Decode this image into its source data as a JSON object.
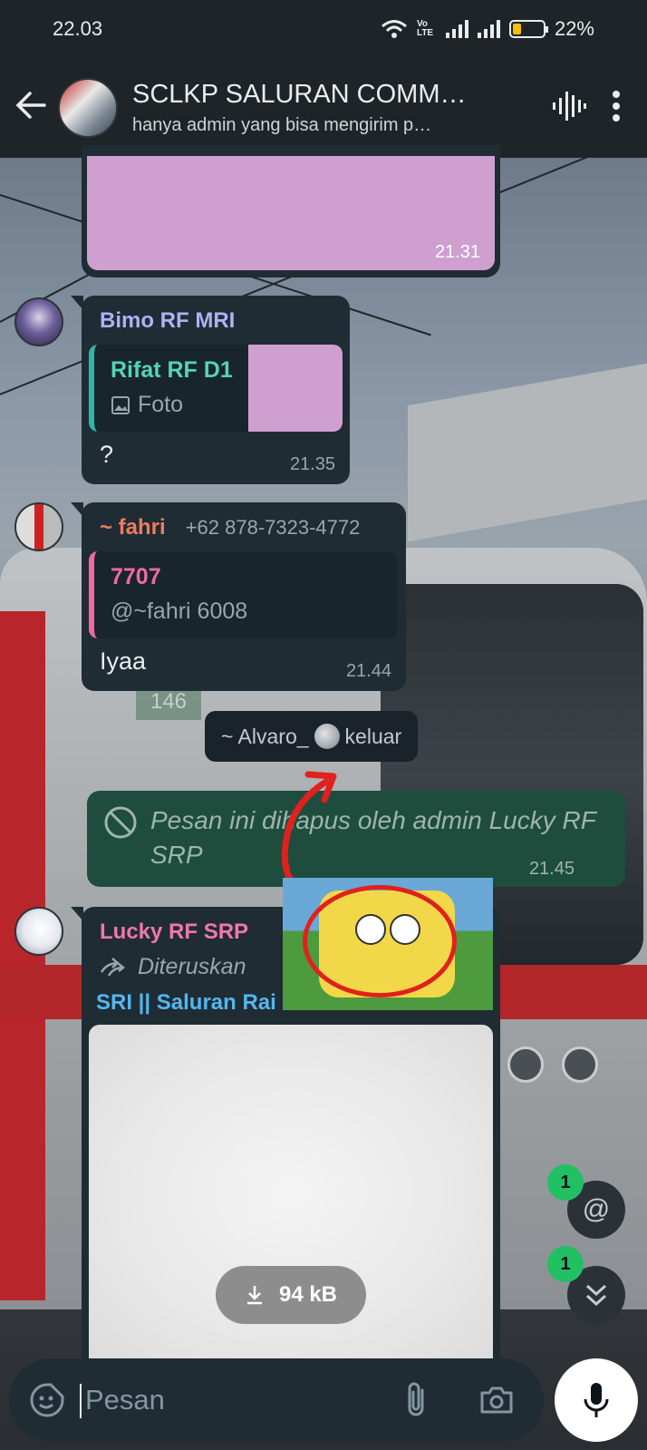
{
  "status_bar": {
    "time": "22.03",
    "volte": "Vo LTE",
    "battery": "22%"
  },
  "header": {
    "title": "SCLKP SALURAN COMM…",
    "subtitle": "hanya admin yang bisa mengirim p…"
  },
  "messages": {
    "m1": {
      "time": "21.31"
    },
    "m2": {
      "sender": "Bimo RF MRI",
      "quote_name": "Rifat RF D1",
      "quote_text": "Foto",
      "text": "?",
      "time": "21.35"
    },
    "m3": {
      "sender": "~ fahri",
      "phone": "+62 878-7323-4772",
      "quote_name": "7707",
      "quote_text": "@~fahri 6008",
      "text": "Iyaa",
      "time": "21.44"
    },
    "system": {
      "text_before": "~ Alvaro_",
      "text_after": "keluar"
    },
    "deleted": {
      "text": "Pesan ini dihapus oleh admin Lucky RF SRP",
      "time": "21.45"
    },
    "m4": {
      "sender": "Lucky RF SRP",
      "forwarded": "Diteruskan",
      "channel": "SRI || Saluran Rai",
      "download_size": "94 kB"
    }
  },
  "badges": {
    "mention_count": "1",
    "scroll_count": "1"
  },
  "input": {
    "placeholder": "Pesan"
  },
  "colors": {
    "bubble": "#1f2c34",
    "deleted_bubble": "#1e4d3d",
    "bimo_name": "#a9b4f5",
    "rifat_name": "#56d3b5",
    "fahri_name": "#ef7b5f",
    "quote_7707": "#f06aa0",
    "lucky_name": "#ef78a8",
    "channel_name": "#53b6f0",
    "badge_green": "#21c063"
  }
}
